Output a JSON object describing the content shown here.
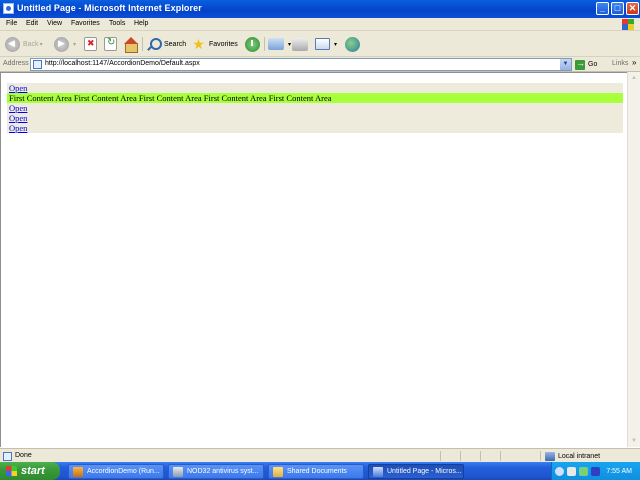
{
  "window": {
    "title": "Untitled Page - Microsoft Internet Explorer",
    "controls": {
      "minimize": "_",
      "maximize": "□",
      "close": "✕"
    }
  },
  "menu": [
    "File",
    "Edit",
    "View",
    "Favorites",
    "Tools",
    "Help"
  ],
  "toolbar": {
    "back_label": "Back",
    "search_label": "Search",
    "favorites_label": "Favorites",
    "icons": [
      "back-icon",
      "forward-icon",
      "stop-icon",
      "refresh-icon",
      "home-icon",
      "search-icon",
      "favorites-star-icon",
      "history-icon",
      "mail-icon",
      "print-icon",
      "edit-icon",
      "messenger-icon"
    ]
  },
  "address": {
    "label": "Address",
    "url": "http://localhost:1147/AccordionDemo/Default.aspx",
    "go_label": "Go",
    "links_label": "Links",
    "chevron": "»"
  },
  "accordion": {
    "panes": [
      {
        "header": "Open",
        "content": "First Content Area First Content Area First Content Area First Content Area First Content Area",
        "expanded": true
      },
      {
        "header": "Open",
        "expanded": false
      },
      {
        "header": "Open",
        "expanded": false
      },
      {
        "header": "Open",
        "expanded": false
      }
    ],
    "colors": {
      "header_bg": "#efebdc",
      "content_bg": "#a8ff3c",
      "link": "#0000ee"
    }
  },
  "status": {
    "text": "Done",
    "zone": "Local intranet"
  },
  "taskbar": {
    "start_label": "start",
    "tasks": [
      {
        "label": "AccordionDemo (Run...",
        "active": false
      },
      {
        "label": "NOD32 antivirus syst...",
        "active": false
      },
      {
        "label": "Shared Documents",
        "active": false
      },
      {
        "label": "Untitled Page - Micros...",
        "active": true
      }
    ],
    "clock": "7:55 AM"
  }
}
